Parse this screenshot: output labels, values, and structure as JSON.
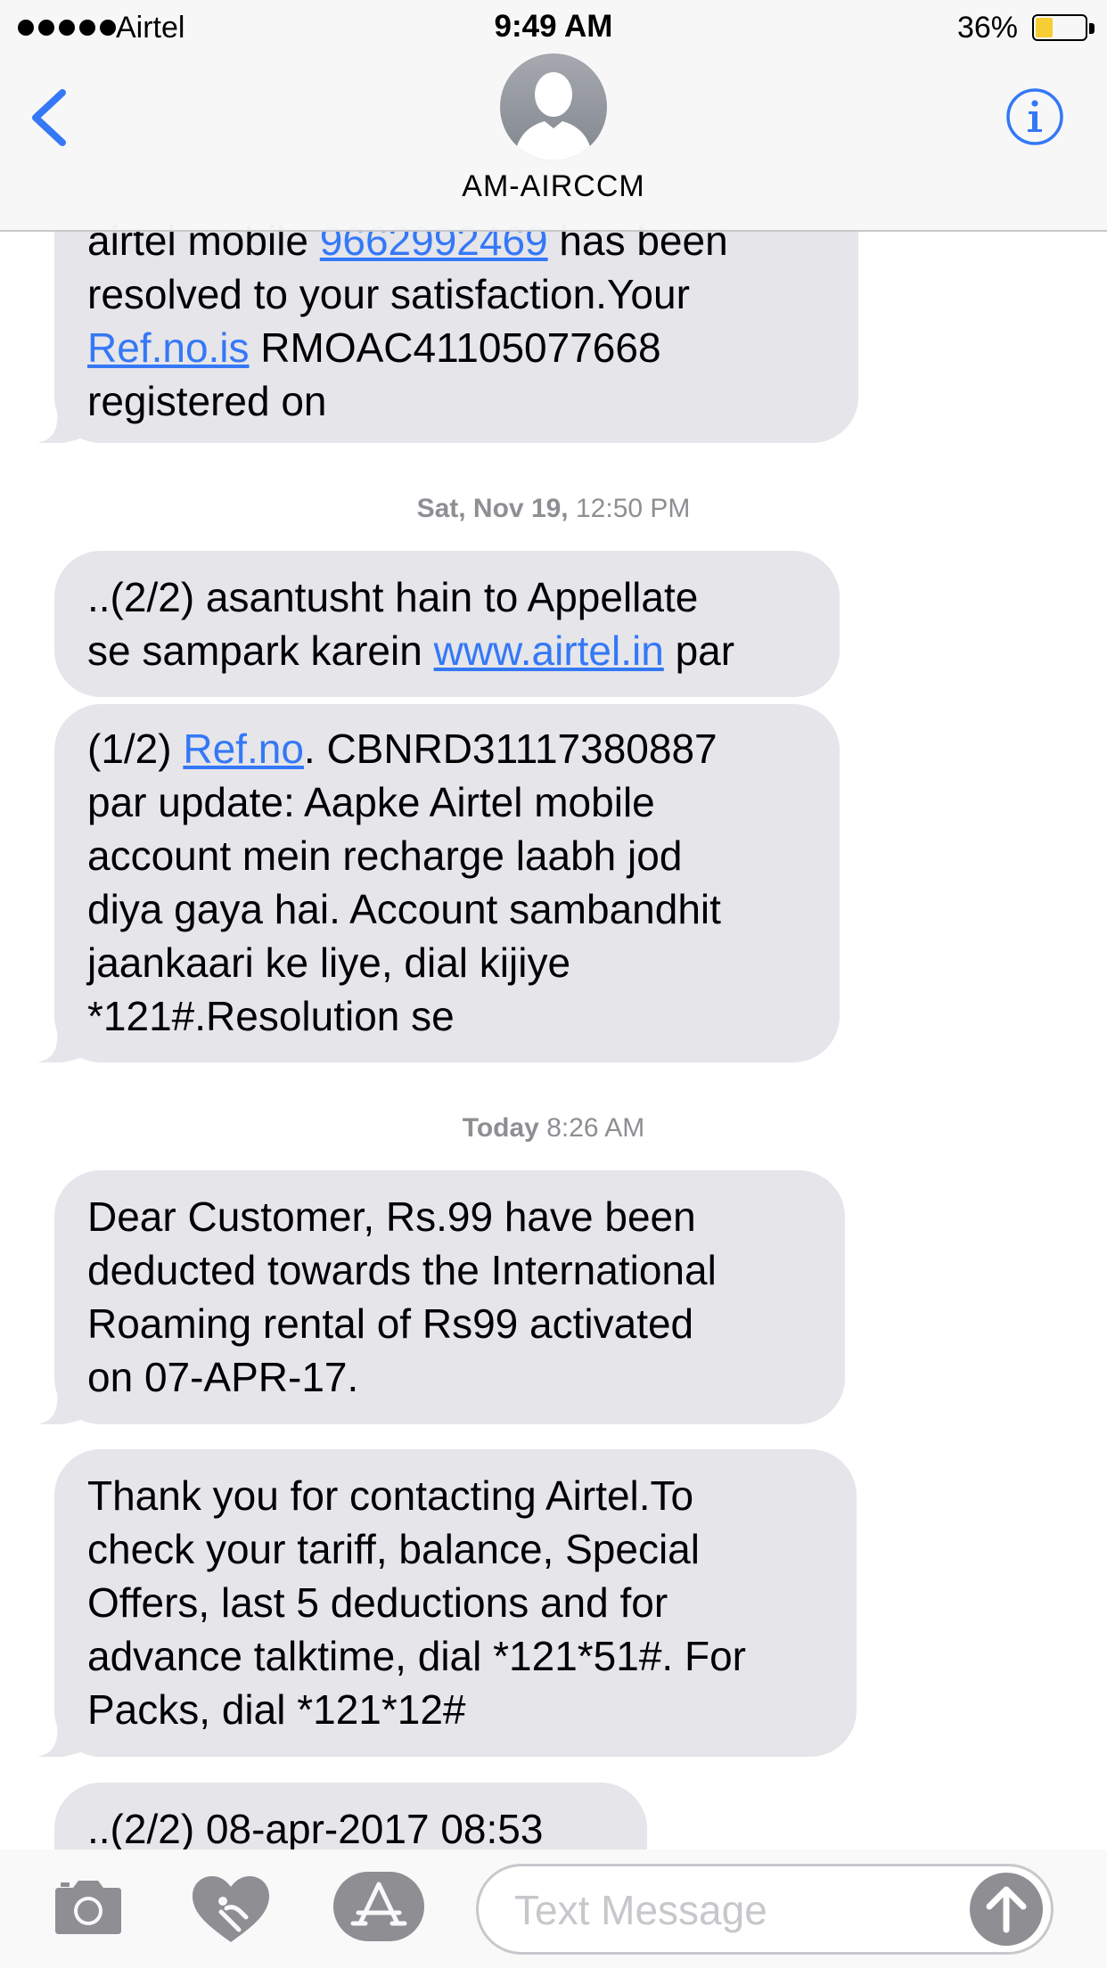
{
  "status_bar": {
    "carrier": "Airtel",
    "time": "9:49 AM",
    "battery_percent": "36%",
    "battery_level": 0.36
  },
  "header": {
    "contact_name": "AM-AIRCCM",
    "back_icon": "chevron-left-icon",
    "info_icon": "info-icon",
    "accent_color": "#3478f6"
  },
  "messages": [
    {
      "lines": [
        [
          {
            "text": "airtel mobile "
          },
          {
            "text": "9662992469",
            "link": true
          },
          {
            "text": " has been"
          }
        ],
        [
          {
            "text": "resolved to your satisfaction.Your"
          }
        ],
        [
          {
            "text": "Ref.no.is",
            "link": true
          },
          {
            "text": " RMOAC41105077668"
          }
        ],
        [
          {
            "text": "registered on"
          }
        ]
      ]
    },
    {
      "lines": [
        [
          {
            "text": "..(2/2) asantusht hain to Appellate"
          }
        ],
        [
          {
            "text": "se sampark karein "
          },
          {
            "text": "www.airtel.in",
            "link": true
          },
          {
            "text": " par"
          }
        ]
      ]
    },
    {
      "lines": [
        [
          {
            "text": "(1/2) "
          },
          {
            "text": "Ref.no",
            "link": true
          },
          {
            "text": ". CBNRD31117380887"
          }
        ],
        [
          {
            "text": "par update: Aapke Airtel mobile"
          }
        ],
        [
          {
            "text": "account mein recharge laabh jod"
          }
        ],
        [
          {
            "text": "diya gaya hai. Account sambandhit"
          }
        ],
        [
          {
            "text": "jaankaari ke liye, dial kijiye"
          }
        ],
        [
          {
            "text": "*121#.Resolution se"
          }
        ]
      ]
    },
    {
      "lines": [
        [
          {
            "text": "Dear Customer, Rs.99 have been"
          }
        ],
        [
          {
            "text": "deducted towards the International"
          }
        ],
        [
          {
            "text": "Roaming rental of Rs99 activated"
          }
        ],
        [
          {
            "text": "on 07-APR-17."
          }
        ]
      ]
    },
    {
      "lines": [
        [
          {
            "text": "Thank you for contacting Airtel.To"
          }
        ],
        [
          {
            "text": "check your tariff, balance, Special"
          }
        ],
        [
          {
            "text": "Offers, last 5 deductions and for"
          }
        ],
        [
          {
            "text": "advance talktime, dial *121*51#. For"
          }
        ],
        [
          {
            "text": "Packs, dial *121*12#"
          }
        ]
      ]
    },
    {
      "lines": [
        [
          {
            "text": "..(2/2) 08-apr-2017 08:53"
          }
        ]
      ]
    }
  ],
  "timestamps": [
    {
      "day": "Sat, Nov 19,",
      "time": "12:50 PM"
    },
    {
      "day": "Today",
      "time": "8:26 AM"
    }
  ],
  "input_bar": {
    "placeholder": "Text Message",
    "camera_icon": "camera-icon",
    "digital_touch_icon": "digital-touch-heart-icon",
    "apps_icon": "app-store-icon",
    "send_icon": "send-arrow-up-icon"
  }
}
